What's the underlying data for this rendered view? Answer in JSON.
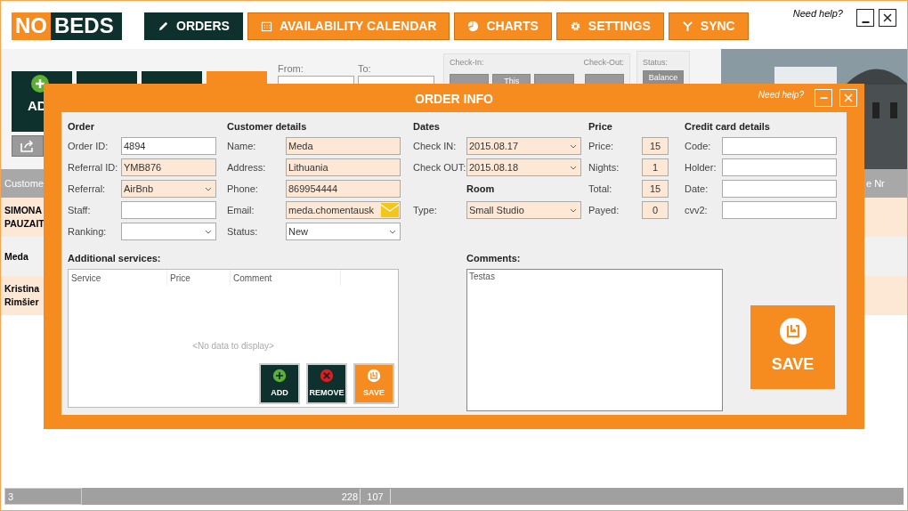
{
  "app": {
    "logo": [
      "NO",
      "BEDS"
    ],
    "need_help": "Need help?"
  },
  "nav": [
    {
      "label": "ORDERS",
      "selected": true
    },
    {
      "label": "AVAILABILITY CALENDAR",
      "selected": false
    },
    {
      "label": "CHARTS",
      "selected": false
    },
    {
      "label": "SETTINGS",
      "selected": false
    },
    {
      "label": "SYNC",
      "selected": false
    }
  ],
  "filters": {
    "from": "From:",
    "to": "To:",
    "check_in": "Check-In:",
    "check_out": "Check-Out:",
    "status": "Status:",
    "this_button": "This",
    "balance_button": "Balance",
    "add_button": "AD"
  },
  "orders_table": {
    "header_left": "Custome",
    "header_right": "e Nr",
    "rows": [
      {
        "customer": "SIMONA PAUZAIT",
        "selected": true
      },
      {
        "customer": "Meda",
        "selected": false
      },
      {
        "customer": "Kristina Rimšier",
        "selected": true
      }
    ]
  },
  "status_bar": [
    "3",
    "228",
    "107"
  ],
  "dialog": {
    "title": "ORDER INFO",
    "need_help": "Need help?",
    "sections": [
      {
        "heading": "Order",
        "fields": [
          {
            "label": "Order ID:",
            "value": "4894",
            "kind": "text",
            "highlighted": false
          },
          {
            "label": "Referral ID:",
            "value": "YMB876",
            "kind": "text",
            "highlighted": true
          },
          {
            "label": "Referral:",
            "value": "AirBnb",
            "kind": "select",
            "highlighted": true
          },
          {
            "label": "Staff:",
            "kind": "text",
            "highlighted": false
          },
          {
            "label": "Ranking:",
            "kind": "select",
            "highlighted": false
          }
        ]
      },
      {
        "heading": "Customer details",
        "fields": [
          {
            "label": "Name:",
            "value": "Meda",
            "kind": "text",
            "highlighted": true
          },
          {
            "label": "Address:",
            "value": "Lithuania",
            "kind": "text",
            "highlighted": true
          },
          {
            "label": "Phone:",
            "value": "869954444",
            "kind": "text",
            "highlighted": true
          },
          {
            "label": "Email:",
            "value": "meda.chomentausk",
            "kind": "email",
            "highlighted": true
          },
          {
            "label": "Status:",
            "value": "New",
            "kind": "select",
            "highlighted": false
          }
        ]
      },
      {
        "heading": "Dates",
        "fields": [
          {
            "label": "Check IN:",
            "value": "2015.08.17",
            "kind": "select",
            "highlighted": true
          },
          {
            "label": "Check OUT:",
            "value": "2015.08.18",
            "kind": "select",
            "highlighted": true
          },
          {
            "label": "Room",
            "kind": "subheading"
          },
          {
            "label": "Type:",
            "value": "Small Studio",
            "kind": "select",
            "highlighted": true
          }
        ]
      },
      {
        "heading": "Price",
        "fields": [
          {
            "label": "Price:",
            "value": "15",
            "kind": "number",
            "highlighted": true
          },
          {
            "label": "Nights:",
            "value": "1",
            "kind": "number",
            "highlighted": true
          },
          {
            "label": "Total:",
            "value": "15",
            "kind": "number",
            "highlighted": true
          },
          {
            "label": "Payed:",
            "value": "0",
            "kind": "number",
            "highlighted": true
          }
        ]
      },
      {
        "heading": "Credit card details",
        "fields": [
          {
            "label": "Code:",
            "kind": "text",
            "highlighted": false
          },
          {
            "label": "Holder:",
            "kind": "text",
            "highlighted": false
          },
          {
            "label": "Date:",
            "kind": "text",
            "highlighted": false
          },
          {
            "label": "cvv2:",
            "kind": "text",
            "highlighted": false
          }
        ]
      }
    ],
    "services": {
      "heading": "Additional services:",
      "columns": [
        "Service",
        "Price",
        "Comment"
      ],
      "empty_text": "<No data to display>",
      "buttons": [
        {
          "label": "ADD",
          "kind": "add"
        },
        {
          "label": "REMOVE",
          "kind": "remove"
        },
        {
          "label": "SAVE",
          "kind": "save"
        }
      ]
    },
    "comments": {
      "heading": "Comments:",
      "value": "Testas"
    },
    "save_button": "SAVE"
  }
}
